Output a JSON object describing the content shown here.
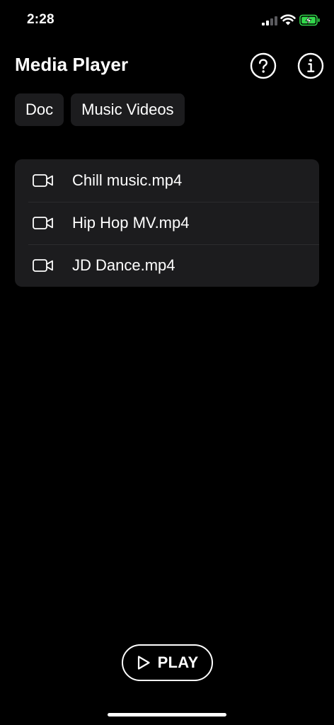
{
  "status_bar": {
    "time": "2:28",
    "signal_icon": "cellular-signal-icon",
    "wifi_icon": "wifi-icon",
    "battery_icon": "battery-charging-icon",
    "battery_color": "#32d74b"
  },
  "header": {
    "title": "Media Player",
    "help_icon": "question-circle-icon",
    "info_icon": "info-circle-icon"
  },
  "chips": [
    {
      "label": "Doc"
    },
    {
      "label": "Music Videos"
    }
  ],
  "files": [
    {
      "name": "Chill music.mp4",
      "icon": "video-camera-icon"
    },
    {
      "name": "Hip Hop MV.mp4",
      "icon": "video-camera-icon"
    },
    {
      "name": "JD Dance.mp4",
      "icon": "video-camera-icon"
    }
  ],
  "play_button": {
    "label": "PLAY",
    "icon": "play-icon"
  },
  "colors": {
    "background": "#000000",
    "surface": "#1c1c1e",
    "text": "#ffffff"
  }
}
